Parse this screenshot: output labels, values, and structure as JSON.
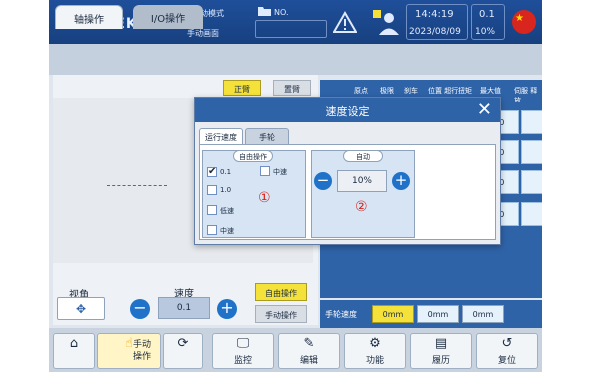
{
  "topbar": {
    "logo": "SWITEK",
    "mode": "手动模式",
    "screen": "手动画面",
    "no_label": "NO.",
    "time": "14:4:19",
    "date": "2023/08/09",
    "ratio": "0.1",
    "percent": "10%"
  },
  "tabs": {
    "axis": "轴操作",
    "io": "I/O操作"
  },
  "left": {
    "yellow_btn": "正臂",
    "grey_btn": "置臂"
  },
  "table": {
    "headers": [
      "原点",
      "极限",
      "刹车",
      "位置 超行",
      "扭矩",
      "最大值",
      "伺服 释放"
    ],
    "values": [
      "0.0",
      "0.0",
      "0.0",
      "0.0"
    ]
  },
  "controls": {
    "view_label": "视角",
    "speed_label": "速度",
    "speed_value": "0.1",
    "free_op": "自由操作",
    "manual_op": "手动操作"
  },
  "handwheel": {
    "label": "手轮速度",
    "values": [
      "0mm",
      "0mm",
      "0mm"
    ]
  },
  "nav": {
    "manual_label": "手动\n操作",
    "items": [
      "监控",
      "编辑",
      "功能",
      "履历",
      "复位"
    ]
  },
  "modal": {
    "title": "速度设定",
    "tab_run": "运行速度",
    "tab_wheel": "手轮",
    "group_free": "自由操作",
    "group_auto": "自动",
    "options": [
      "0.1",
      "1.0",
      "低速",
      "中速",
      "中速"
    ],
    "auto_value": "10%",
    "marker1": "①",
    "marker2": "②"
  },
  "colors": {
    "accent": "#2f63a8",
    "highlight": "#f4e23b",
    "alert": "#d8261f"
  }
}
